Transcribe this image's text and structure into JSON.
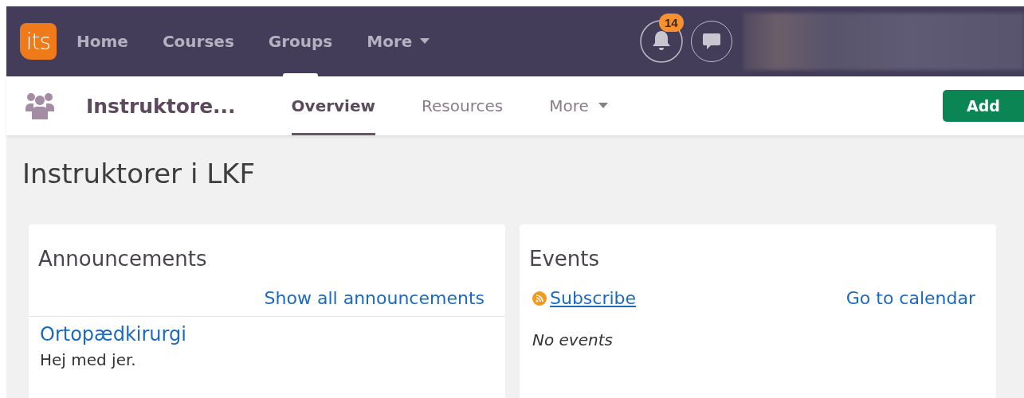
{
  "logo": {
    "text": "its"
  },
  "top_nav": [
    {
      "label": "Home",
      "selected": false,
      "dropdown": false
    },
    {
      "label": "Courses",
      "selected": false,
      "dropdown": false
    },
    {
      "label": "Groups",
      "selected": true,
      "dropdown": false
    },
    {
      "label": "More",
      "selected": false,
      "dropdown": true
    }
  ],
  "notifications": {
    "count": "14"
  },
  "group_bar": {
    "title": "Instruktore...",
    "tabs": [
      {
        "label": "Overview",
        "selected": true,
        "dropdown": false
      },
      {
        "label": "Resources",
        "selected": false,
        "dropdown": false
      },
      {
        "label": "More",
        "selected": false,
        "dropdown": true
      }
    ],
    "add_button": "Add"
  },
  "page_title": "Instruktorer i LKF",
  "announcements": {
    "title": "Announcements",
    "link": "Show all announcements",
    "items": [
      {
        "title": "Ortopædkirurgi",
        "text": "Hej med jer."
      }
    ]
  },
  "events": {
    "title": "Events",
    "subscribe": "Subscribe",
    "calendar_link": "Go to calendar",
    "empty": "No events"
  }
}
